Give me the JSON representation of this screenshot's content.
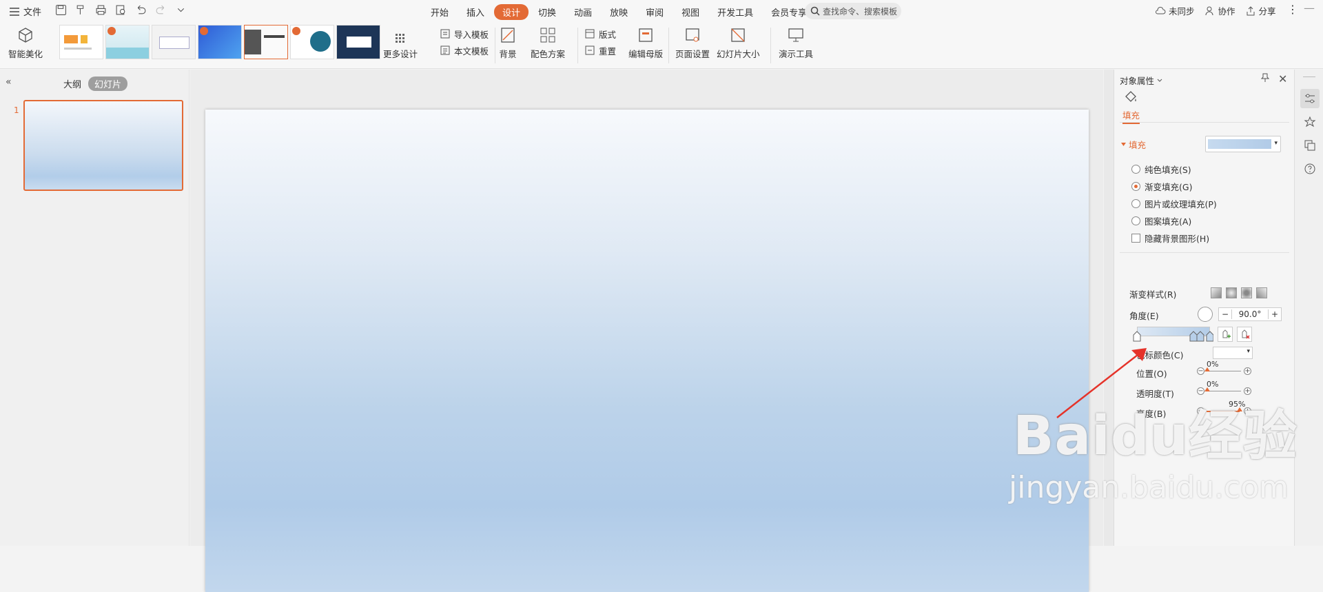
{
  "menubar": {
    "file_label": "文件",
    "tabs": [
      "开始",
      "插入",
      "设计",
      "切换",
      "动画",
      "放映",
      "审阅",
      "视图",
      "开发工具",
      "会员专享"
    ],
    "active_tab": "设计",
    "search_placeholder": "查找命令、搜索模板",
    "sync_label": "未同步",
    "collab_label": "协作",
    "share_label": "分享"
  },
  "ribbon": {
    "smart_beautify": "智能美化",
    "more_design": "更多设计",
    "import_template": "导入模板",
    "body_template": "本文模板",
    "background": "背景",
    "color_scheme": "配色方案",
    "layout": "版式",
    "reset": "重置",
    "edit_master": "编辑母版",
    "page_setup": "页面设置",
    "slide_size": "幻灯片大小",
    "present_tools": "演示工具"
  },
  "left_panel": {
    "tab_outline": "大纲",
    "tab_slides": "幻灯片",
    "slide_number": "1"
  },
  "props": {
    "title": "对象属性",
    "tab_fill": "填充",
    "section_fill": "填充",
    "options": {
      "solid": "纯色填充(S)",
      "gradient": "渐变填充(G)",
      "picture": "图片或纹理填充(P)",
      "pattern": "图案填充(A)",
      "hide_bg": "隐藏背景图形(H)"
    },
    "gradient_style": "渐变样式(R)",
    "angle_label": "角度(E)",
    "angle_value": "90.0°",
    "stop_color": "色标颜色(C)",
    "position_label": "位置(O)",
    "position_value": "0%",
    "transparency_label": "透明度(T)",
    "transparency_value": "0%",
    "brightness_label": "亮度(B)",
    "brightness_value": "95%",
    "brightness_fraction": 0.95
  },
  "watermark": {
    "main": "Baidu经验",
    "sub": "jingyan.baidu.com"
  },
  "colors": {
    "accent": "#e36a35",
    "slide_top": "#f7f9fc",
    "slide_mid": "#b0cbe8"
  }
}
